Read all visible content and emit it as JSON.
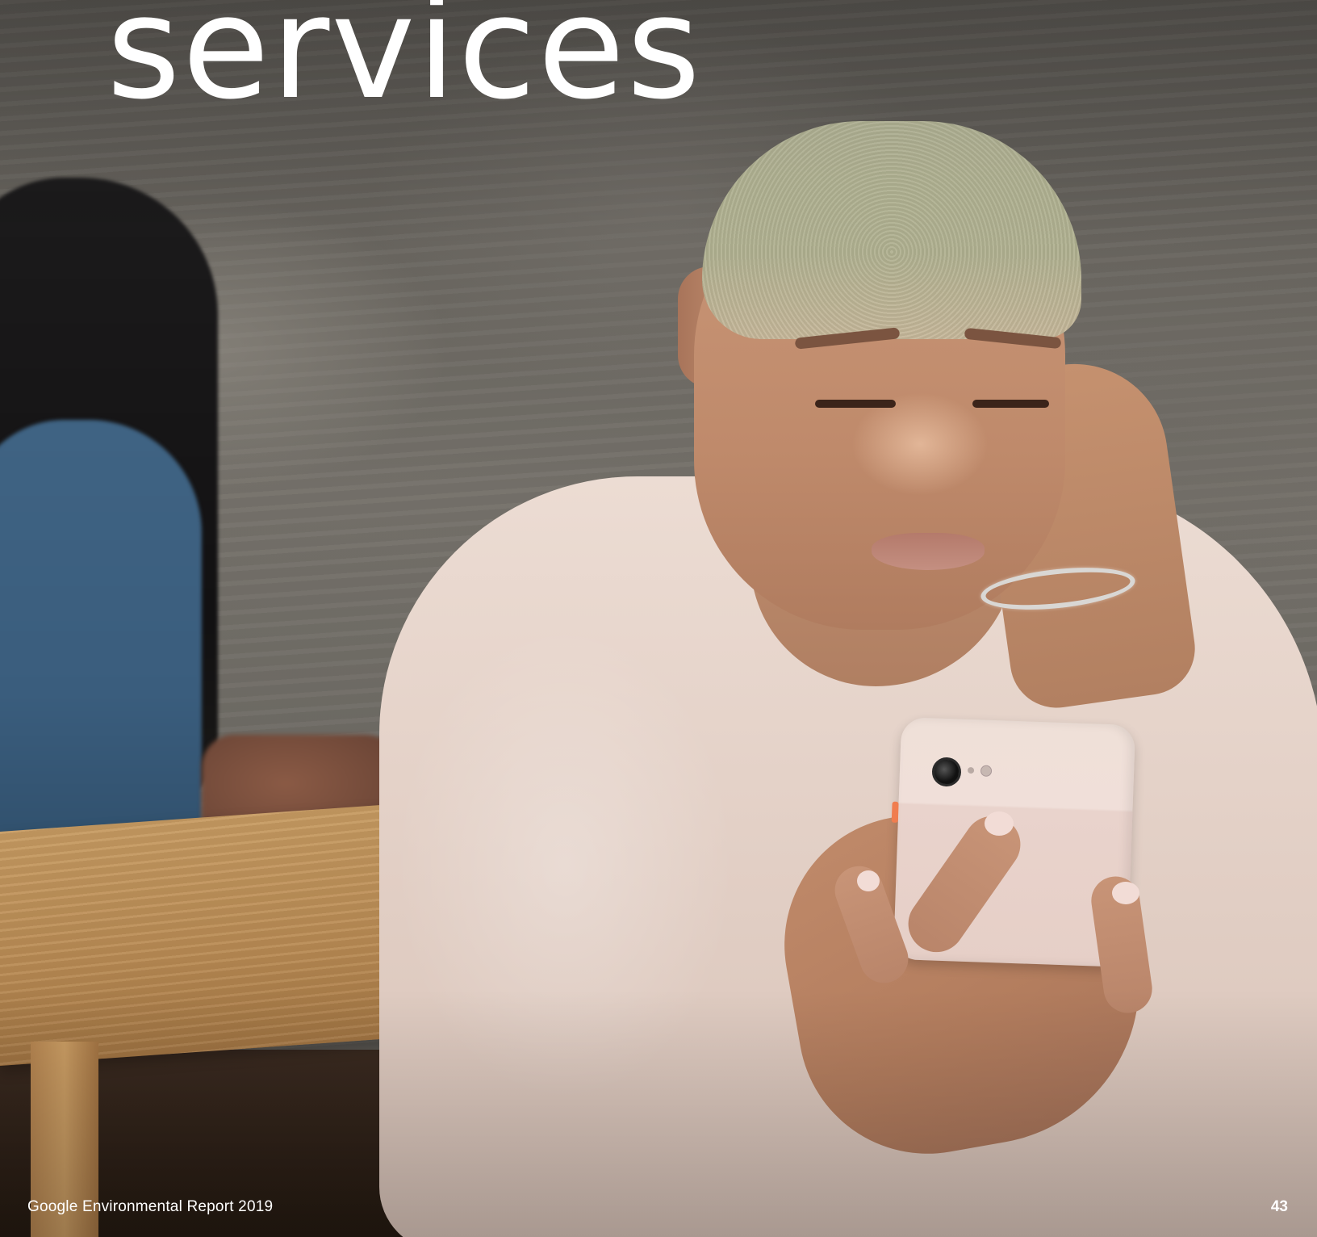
{
  "page": {
    "heading": "services",
    "footer_title": "Google Environmental Report 2019",
    "page_number": "43"
  },
  "photo": {
    "text_color": "#ffffff"
  }
}
